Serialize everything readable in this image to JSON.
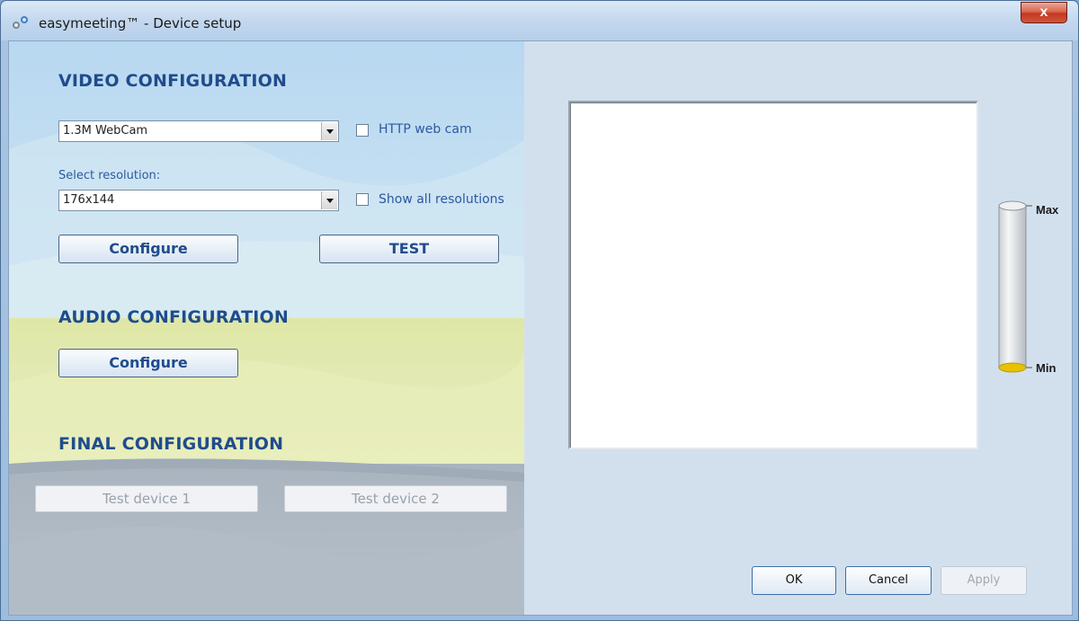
{
  "window": {
    "title": "easymeeting™ - Device setup",
    "close_glyph": "x"
  },
  "video": {
    "heading": "VIDEO CONFIGURATION",
    "device_value": "1.3M WebCam",
    "http_webcam_label": "HTTP web cam",
    "http_webcam_checked": false,
    "resolution_caption": "Select resolution:",
    "resolution_value": "176x144",
    "show_all_label": "Show all resolutions",
    "show_all_checked": false,
    "configure_label": "Configure",
    "test_label": "TEST"
  },
  "audio": {
    "heading": "AUDIO CONFIGURATION",
    "configure_label": "Configure"
  },
  "final": {
    "heading": "FINAL CONFIGURATION",
    "test_device_1_label": "Test device 1",
    "test_device_2_label": "Test device 2"
  },
  "level_meter": {
    "max_label": "Max",
    "min_label": "Min",
    "level": 0
  },
  "dialog_buttons": {
    "ok_label": "OK",
    "cancel_label": "Cancel",
    "apply_label": "Apply"
  },
  "colors": {
    "heading": "#1f4c8c",
    "close_button": "#c2381f",
    "meter_fill": "#e8c200"
  },
  "icons": {
    "app": "easymeeting-app-icon",
    "dropdown": "chevron-down-icon",
    "close": "close-icon"
  }
}
